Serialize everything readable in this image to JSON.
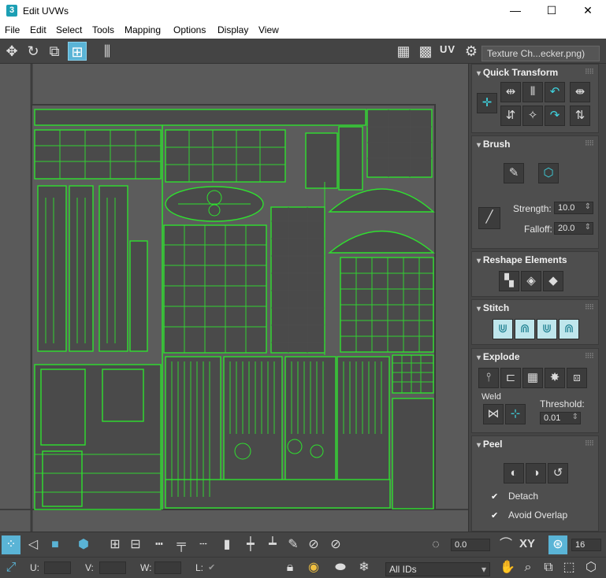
{
  "window": {
    "title": "Edit UVWs",
    "app_icon_glyph": "3",
    "min_glyph": "—",
    "max_glyph": "☐",
    "close_glyph": "✕"
  },
  "menu": [
    "File",
    "Edit",
    "Select",
    "Tools",
    "Mapping",
    "Options",
    "Display",
    "View"
  ],
  "toolbar": {
    "uv_label": "UV",
    "texture_dropdown": "Texture Ch...ecker.png)"
  },
  "rollouts": {
    "quick_transform": {
      "title": "Quick Transform"
    },
    "brush": {
      "title": "Brush",
      "strength_label": "Strength:",
      "strength_value": "10.0",
      "falloff_label": "Falloff:",
      "falloff_value": "20.0"
    },
    "reshape": {
      "title": "Reshape Elements"
    },
    "stitch": {
      "title": "Stitch"
    },
    "explode": {
      "title": "Explode",
      "weld_label": "Weld",
      "threshold_label": "Threshold:",
      "threshold_value": "0.01"
    },
    "peel": {
      "title": "Peel",
      "detach_label": "Detach",
      "avoid_overlap_label": "Avoid Overlap",
      "detach_checked": true,
      "avoid_overlap_checked": true
    }
  },
  "bottom": {
    "rotate_value": "0.0",
    "xy_label": "XY",
    "grid_value": "16",
    "u_label": "U:",
    "v_label": "V:",
    "w_label": "W:",
    "l_label": "L:",
    "ids_dropdown": "All IDs"
  },
  "colors": {
    "uv_green": "#2fe02f",
    "accent_blue": "#5ab4d6",
    "viewport_bg": "#5a5a5a"
  }
}
